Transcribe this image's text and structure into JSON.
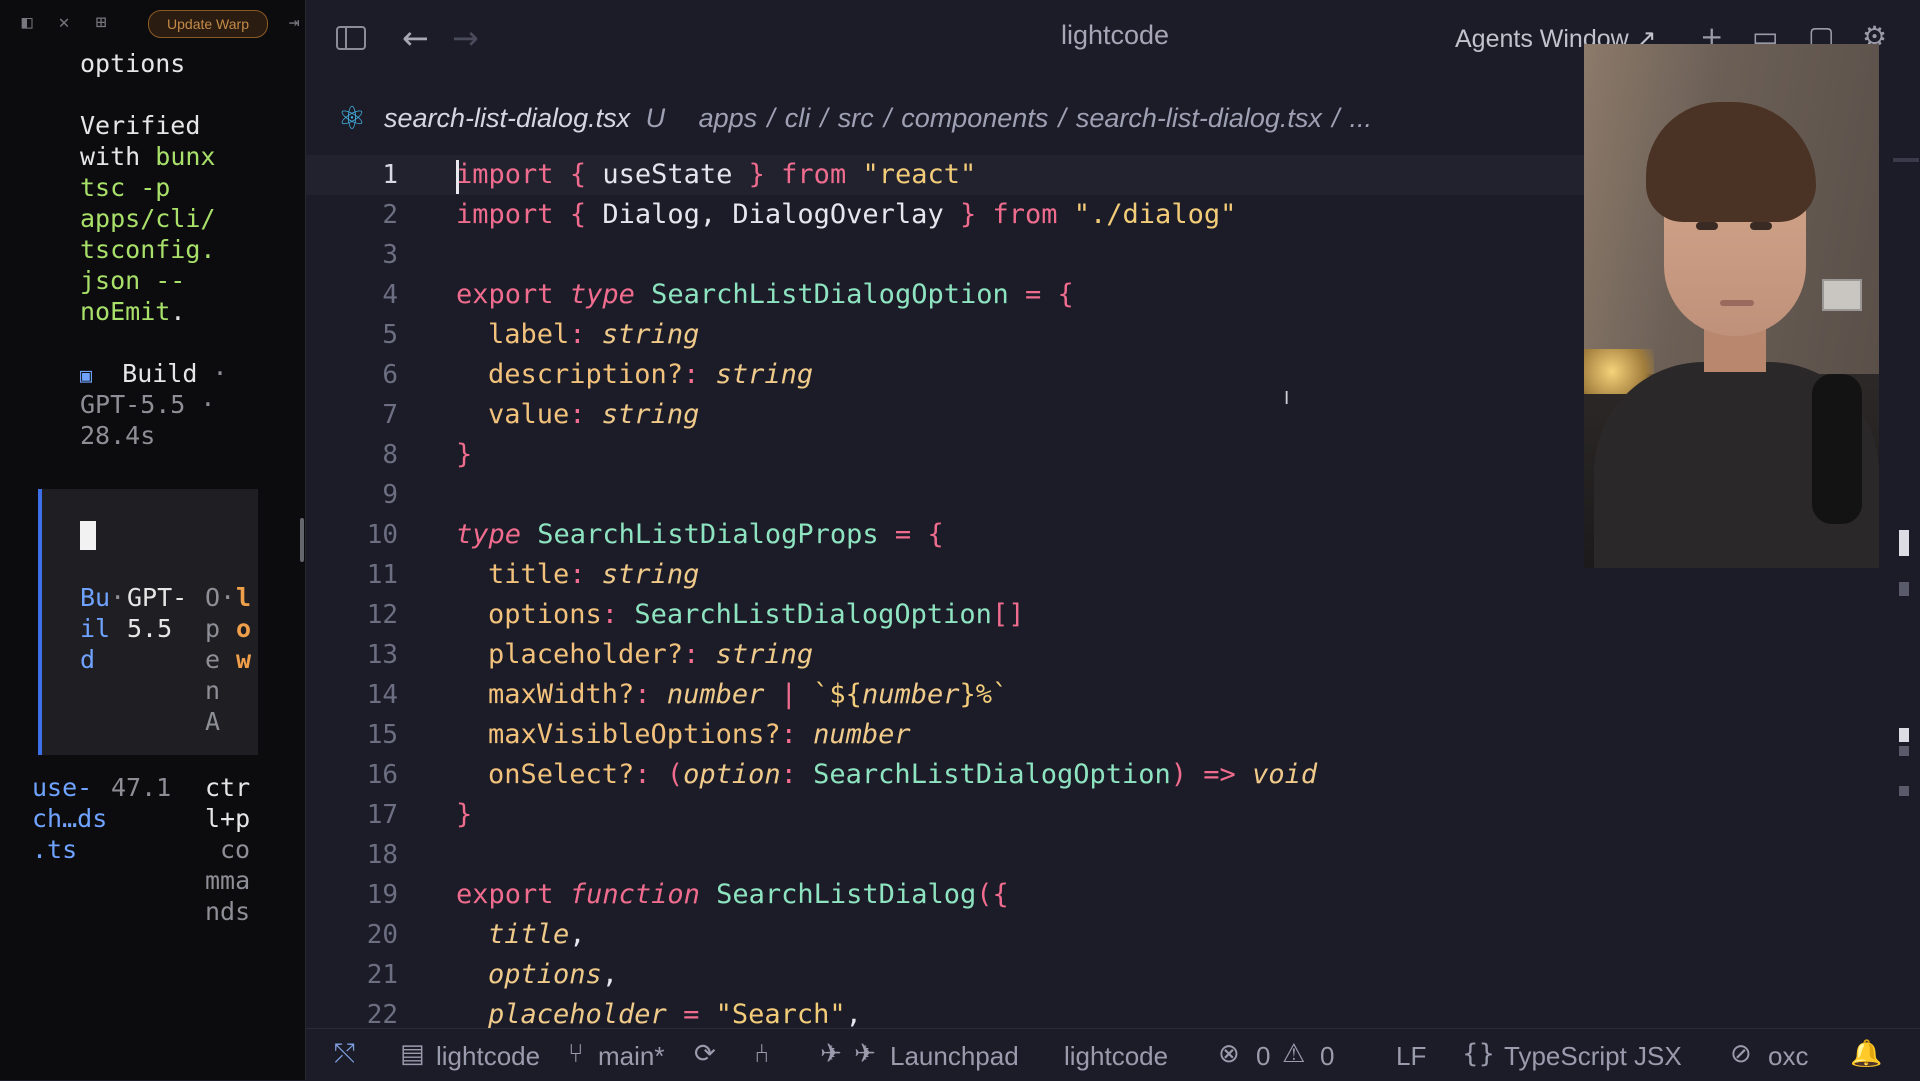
{
  "terminal": {
    "update_button": "Update Warp",
    "lines": {
      "options": "options",
      "verified_1": "Verified",
      "verified_2a": "with ",
      "verified_2b": "bunx",
      "verified_3": "tsc -p",
      "verified_4": "apps/cli/",
      "verified_5": "tsconfig.",
      "verified_6": "json --",
      "verified_7": "noEmit",
      "verified_7b": ".",
      "build_icon": "▣",
      "build_label": "Build",
      "build_dot": "·",
      "build_model": "GPT-5.5",
      "build_dot2": "·",
      "build_time": "28.4s"
    },
    "card": {
      "col1": [
        "Bu",
        "il",
        "d"
      ],
      "col2": [
        "GPT-",
        "5.5"
      ],
      "col3": [
        "O",
        "p",
        "e",
        "n",
        "A"
      ],
      "col3_dots": [
        "·",
        ""
      ],
      "col4": [
        "l",
        "o",
        "w"
      ],
      "col1_dot": "·"
    },
    "footer": {
      "file_1": "use-",
      "file_2": "ch…ds",
      "file_3": ".ts",
      "size": "47.1",
      "hint_1": "ctr",
      "hint_2": "l+p",
      "hint_3": "co",
      "hint_4": "mma",
      "hint_5": "nds"
    }
  },
  "window": {
    "title": "lightcode",
    "agents_window": "Agents Window",
    "agents_icon": "external-link-icon"
  },
  "breadcrumb": {
    "file": "search-list-dialog.tsx",
    "status": "U",
    "path": [
      "apps",
      "cli",
      "src",
      "components",
      "search-list-dialog.tsx",
      "..."
    ]
  },
  "editor": {
    "current_line": 1,
    "line_numbers": [
      "1",
      "2",
      "3",
      "4",
      "5",
      "6",
      "7",
      "8",
      "9",
      "10",
      "11",
      "12",
      "13",
      "14",
      "15",
      "16",
      "17",
      "18",
      "19",
      "20",
      "21",
      "22"
    ],
    "code": {
      "l1": [
        "import",
        " ",
        "{",
        " useState ",
        "}",
        " ",
        "from",
        " ",
        "\"react\""
      ],
      "l2": [
        "import",
        " ",
        "{",
        " Dialog, DialogOverlay ",
        "}",
        " ",
        "from",
        " ",
        "\"./dialog\""
      ],
      "l4": [
        "export",
        " ",
        "type",
        " ",
        "SearchListDialogOption",
        " = ",
        "{"
      ],
      "l5": [
        "label",
        ": ",
        "string"
      ],
      "l6": [
        "description?",
        ": ",
        "string"
      ],
      "l7": [
        "value",
        ": ",
        "string"
      ],
      "l8": [
        "}"
      ],
      "l10": [
        "type",
        " ",
        "SearchListDialogProps",
        " = ",
        "{"
      ],
      "l11": [
        "title",
        ": ",
        "string"
      ],
      "l12": [
        "options",
        ": ",
        "SearchListDialogOption",
        "[]"
      ],
      "l13": [
        "placeholder?",
        ": ",
        "string"
      ],
      "l14": [
        "maxWidth?",
        ": ",
        "number",
        " | ",
        "`${",
        "number",
        "}%`"
      ],
      "l15": [
        "maxVisibleOptions?",
        ": ",
        "number"
      ],
      "l16": [
        "onSelect?",
        ": ",
        "(",
        "option",
        ": ",
        "SearchListDialogOption",
        ")",
        " => ",
        "void"
      ],
      "l17": [
        "}"
      ],
      "l19": [
        "export",
        " ",
        "function",
        " ",
        "SearchListDialog",
        "(",
        "{"
      ],
      "l20": [
        "title",
        ","
      ],
      "l21": [
        "options",
        ","
      ],
      "l22": [
        "placeholder",
        " = ",
        "\"Search\"",
        ","
      ]
    }
  },
  "statusbar": {
    "branch_icon": "git-merge-icon",
    "workspace": "lightcode",
    "branch": "main*",
    "launchpad": "Launchpad",
    "project": "lightcode",
    "errors": "0",
    "warnings": "0",
    "eol": "LF",
    "language": "TypeScript JSX",
    "linter": "oxc"
  },
  "colors": {
    "keyword": "#f06c8e",
    "type": "#8ee3c0",
    "string": "#f3cc7a",
    "background": "#1b1c27",
    "terminal_bg": "#0c0c0e",
    "accent_blue": "#3d6fe8"
  }
}
